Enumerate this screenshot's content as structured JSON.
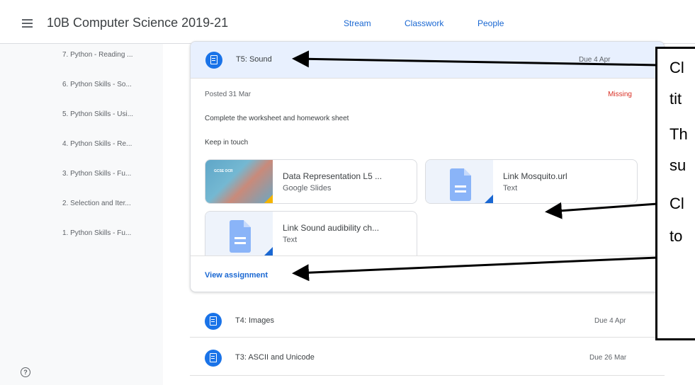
{
  "header": {
    "title": "10B Computer Science 2019-21",
    "tabs": [
      {
        "label": "Stream"
      },
      {
        "label": "Classwork"
      },
      {
        "label": "People"
      }
    ]
  },
  "sidebar": {
    "items": [
      {
        "label": "7. Python - Reading ..."
      },
      {
        "label": "6. Python Skills - So..."
      },
      {
        "label": "5. Python Skills - Usi..."
      },
      {
        "label": "4. Python Skills - Re..."
      },
      {
        "label": "3. Python Skills - Fu..."
      },
      {
        "label": "2. Selection and Iter..."
      },
      {
        "label": "1. Python Skills - Fu..."
      }
    ]
  },
  "expanded_assignment": {
    "title": "T5: Sound",
    "due": "Due 4 Apr",
    "posted": "Posted 31 Mar",
    "status": "Missing",
    "description": "Complete the worksheet and homework sheet",
    "note": "Keep in touch",
    "attachments": [
      {
        "title": "Data Representation L5 ...",
        "type": "Google Slides",
        "thumb_text": "GCSE OCR"
      },
      {
        "title": "Link Mosquito.url",
        "type": "Text"
      },
      {
        "title": "Link Sound audibility ch...",
        "type": "Text"
      }
    ],
    "view_label": "View assignment"
  },
  "assignments": [
    {
      "title": "T4: Images",
      "due": "Due 4 Apr"
    },
    {
      "title": "T3: ASCII and Unicode",
      "due": "Due 26 Mar"
    }
  ],
  "callout": {
    "lines": [
      "Cl",
      "tit",
      "Th",
      "su",
      "Cl",
      "to"
    ]
  },
  "colors": {
    "accent": "#1967d2",
    "missing": "#d93025",
    "header_highlight": "#e8f0fe"
  }
}
